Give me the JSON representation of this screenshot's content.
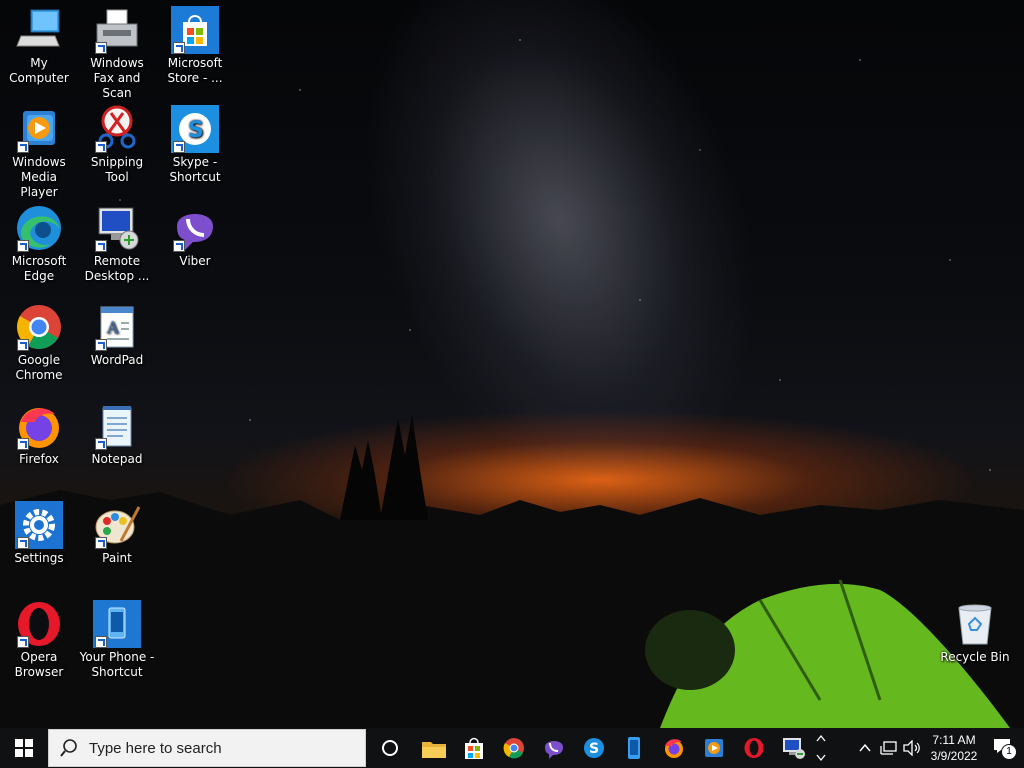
{
  "desktop": {
    "icons": [
      {
        "label": "My Computer",
        "shortcut": false,
        "icon": "computer-icon"
      },
      {
        "label": "Windows Media Player",
        "shortcut": true,
        "icon": "media-player-icon"
      },
      {
        "label": "Microsoft Edge",
        "shortcut": true,
        "icon": "edge-icon"
      },
      {
        "label": "Google Chrome",
        "shortcut": true,
        "icon": "chrome-icon"
      },
      {
        "label": "Firefox",
        "shortcut": true,
        "icon": "firefox-icon"
      },
      {
        "label": "Settings",
        "shortcut": true,
        "icon": "settings-gear-icon"
      },
      {
        "label": "Opera Browser",
        "shortcut": true,
        "icon": "opera-icon"
      },
      {
        "label": "Windows Fax and Scan",
        "shortcut": true,
        "icon": "fax-icon"
      },
      {
        "label": "Snipping Tool",
        "shortcut": true,
        "icon": "scissors-icon"
      },
      {
        "label": "Remote Desktop ...",
        "shortcut": true,
        "icon": "remote-desktop-icon"
      },
      {
        "label": "WordPad",
        "shortcut": true,
        "icon": "wordpad-icon"
      },
      {
        "label": "Notepad",
        "shortcut": true,
        "icon": "notepad-icon"
      },
      {
        "label": "Paint",
        "shortcut": true,
        "icon": "paint-palette-icon"
      },
      {
        "label": "Your Phone - Shortcut",
        "shortcut": true,
        "icon": "phone-icon"
      },
      {
        "label": "Microsoft Store - ...",
        "shortcut": true,
        "icon": "store-icon"
      },
      {
        "label": "Skype - Shortcut",
        "shortcut": true,
        "icon": "skype-icon"
      },
      {
        "label": "Viber",
        "shortcut": true,
        "icon": "viber-icon"
      }
    ],
    "recycle_bin": {
      "label": "Recycle Bin",
      "icon": "recycle-bin-icon"
    }
  },
  "taskbar": {
    "search_placeholder": "Type here to search",
    "pinned": [
      "file-explorer-icon",
      "store-icon",
      "chrome-icon",
      "viber-icon",
      "skype-icon",
      "phone-icon",
      "firefox-icon",
      "media-player-icon",
      "opera-icon",
      "remote-desktop-icon"
    ],
    "clock_time": "7:11 AM",
    "clock_date": "3/9/2022",
    "notification_count": "1"
  }
}
